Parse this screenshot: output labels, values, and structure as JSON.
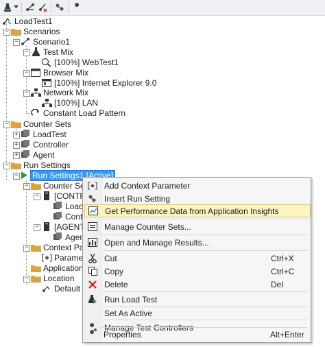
{
  "toolbar": {
    "buttons": [
      "add-test-icon",
      "dropdown-arrow-icon",
      "add-scenario-icon",
      "add-counter-icon",
      "properties-icon",
      "wrench-icon"
    ]
  },
  "tree": {
    "root": "LoadTest1",
    "scenarios": "Scenarios",
    "scenario1": "Scenario1",
    "test_mix": "Test Mix",
    "webtest": "[100%] WebTest1",
    "browser_mix": "Browser Mix",
    "ie": "[100%] Internet Explorer 9.0",
    "network_mix": "Network Mix",
    "lan": "[100%] LAN",
    "load_pattern": "Constant Load Pattern",
    "counter_sets": "Counter Sets",
    "cs_loadtest": "LoadTest",
    "cs_controller": "Controller",
    "cs_agent": "Agent",
    "run_settings": "Run Settings",
    "run_settings1": "Run Settings1 [Active]",
    "counter_set_mappings": "Counter Set M",
    "control_node": "[CONTRO",
    "load_node": "LoadT",
    "contr_node": "Contr",
    "agent_node": "[AGENT N",
    "agent_child": "Agen",
    "context_params": "Context Para",
    "parameter": "Paramete",
    "applications": "Applications",
    "location": "Location",
    "default": "Default"
  },
  "context_menu": {
    "items": [
      {
        "label": "Add Context Parameter",
        "shortcut": "",
        "icon": "context-param-icon"
      },
      {
        "label": "Insert Run Setting",
        "shortcut": "",
        "icon": "insert-setting-icon"
      },
      {
        "label": "Get Performance Data from Application Insights",
        "shortcut": "",
        "icon": "app-insights-icon"
      },
      {
        "label": "Manage Counter Sets...",
        "shortcut": "",
        "icon": "counter-sets-icon"
      },
      {
        "label": "Open and Manage Results...",
        "shortcut": "",
        "icon": "results-icon"
      },
      {
        "label": "Cut",
        "shortcut": "Ctrl+X",
        "icon": "scissors-icon"
      },
      {
        "label": "Copy",
        "shortcut": "Ctrl+C",
        "icon": "copy-icon"
      },
      {
        "label": "Delete",
        "shortcut": "Del",
        "icon": "delete-icon"
      },
      {
        "label": "Run Load Test",
        "shortcut": "",
        "icon": "run-test-icon"
      },
      {
        "label": "Set As Active",
        "shortcut": "",
        "icon": ""
      },
      {
        "label": "Manage Test Controllers",
        "shortcut": "",
        "icon": "controllers-icon"
      },
      {
        "label": "Properties",
        "shortcut": "Alt+Enter",
        "icon": "wrench-icon"
      }
    ],
    "highlighted": "Get Performance Data from Application Insights"
  },
  "colors": {
    "selection": "#3399ff",
    "folder": "#d9a441",
    "highlight": "#fdf4bf",
    "delete": "#d11f1f",
    "run": "#2e9c3b"
  }
}
